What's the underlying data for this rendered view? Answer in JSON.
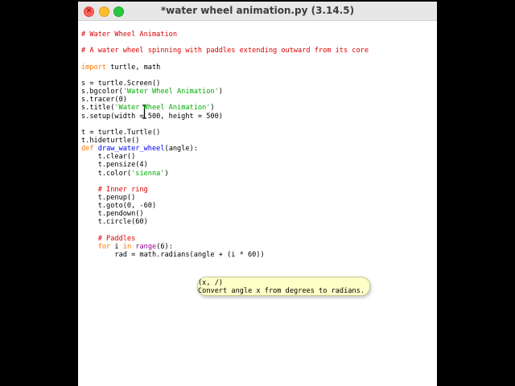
{
  "window": {
    "title": "*water wheel animation.py (3.14.5)",
    "traffic_lights": [
      "close",
      "minimize",
      "zoom"
    ],
    "close_glyph": "✕"
  },
  "code": {
    "lines": [
      [
        {
          "t": "# Water Wheel Animation",
          "c": "cm"
        }
      ],
      [],
      [
        {
          "t": "# A water wheel spinning with paddles extending outward from its core",
          "c": "cm"
        }
      ],
      [],
      [
        {
          "t": "import",
          "c": "kw"
        },
        {
          "t": " turtle, math"
        }
      ],
      [],
      [
        {
          "t": "s = turtle.Screen()"
        }
      ],
      [
        {
          "t": "s.bgcolor("
        },
        {
          "t": "'Water Wheel Animation'",
          "c": "st"
        },
        {
          "t": ")"
        }
      ],
      [
        {
          "t": "s.tracer(0)"
        }
      ],
      [
        {
          "t": "s.title("
        },
        {
          "t": "'Water Wheel Animation'",
          "c": "st"
        },
        {
          "t": ")"
        }
      ],
      [
        {
          "t": "s.setup(width = 500, height = 500)"
        }
      ],
      [],
      [
        {
          "t": "t = turtle.Turtle()"
        }
      ],
      [
        {
          "t": "t.hideturtle()"
        }
      ],
      [
        {
          "t": "def",
          "c": "kw"
        },
        {
          "t": " "
        },
        {
          "t": "draw_water_wheel",
          "c": "df"
        },
        {
          "t": "(angle):"
        }
      ],
      [
        {
          "t": "    t.clear()"
        }
      ],
      [
        {
          "t": "    t.pensize(4)"
        }
      ],
      [
        {
          "t": "    t.color("
        },
        {
          "t": "'sienna'",
          "c": "st"
        },
        {
          "t": ")"
        }
      ],
      [],
      [
        {
          "t": "    # Inner ring",
          "c": "cm"
        }
      ],
      [
        {
          "t": "    t.penup()"
        }
      ],
      [
        {
          "t": "    t.goto(0, -60)"
        }
      ],
      [
        {
          "t": "    t.pendown()"
        }
      ],
      [
        {
          "t": "    t.circle(60)"
        }
      ],
      [],
      [
        {
          "t": "    # Paddles",
          "c": "cm"
        }
      ],
      [
        {
          "t": "    "
        },
        {
          "t": "for",
          "c": "kw"
        },
        {
          "t": " i "
        },
        {
          "t": "in",
          "c": "kw"
        },
        {
          "t": " "
        },
        {
          "t": "range",
          "c": "bi"
        },
        {
          "t": "(6):"
        }
      ],
      [
        {
          "t": "        rad = math.radians(angle + (i * 60))"
        }
      ]
    ]
  },
  "calltip": {
    "signature": "(x, /)",
    "description": "Convert angle x from degrees to radians."
  },
  "colors": {
    "comment": "#dd0000",
    "keyword": "#ff7700",
    "string": "#00aa00",
    "definition": "#0000ff",
    "builtin": "#900090",
    "calltip_bg": "#ffffc8"
  },
  "icons": [
    "close-icon",
    "text-cursor-icon"
  ]
}
